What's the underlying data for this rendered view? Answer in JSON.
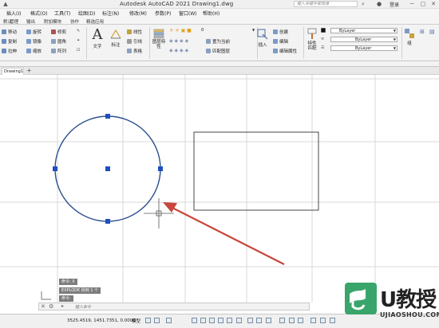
{
  "window": {
    "title": "Autodesk AutoCAD 2021    Drawing1.dwg",
    "search_placeholder": "键入关键字或短语",
    "login": "登录"
  },
  "menubar": [
    "插入(I)",
    "格式(O)",
    "工具(T)",
    "绘图(D)",
    "标注(N)",
    "修改(M)",
    "参数(P)",
    "窗口(W)",
    "帮助(H)"
  ],
  "ribbon_tabs": [
    "默认",
    "管理",
    "输出",
    "附加模块",
    "协作",
    "精选应用"
  ],
  "ribbon": {
    "modify": [
      {
        "label": "移动",
        "icon": "move-icon"
      },
      {
        "label": "旋转",
        "icon": "rotate-icon"
      },
      {
        "label": "修剪",
        "icon": "trim-icon"
      },
      {
        "label": "复制",
        "icon": "copy-icon"
      },
      {
        "label": "镜像",
        "icon": "mirror-icon"
      },
      {
        "label": "圆角",
        "icon": "fillet-icon"
      },
      {
        "label": "拉伸",
        "icon": "stretch-icon"
      },
      {
        "label": "缩放",
        "icon": "scale-icon"
      },
      {
        "label": "阵列",
        "icon": "array-icon"
      }
    ],
    "annotation": {
      "text": "文字",
      "dimension": "标注",
      "linear": "线性",
      "leader": "引线",
      "table": "表格"
    },
    "layers": {
      "layer_properties": "图层特性",
      "current_layer": "0",
      "make_current": "置为当前",
      "match_layer": "匹配图层"
    },
    "block": {
      "insert": "插入",
      "create": "创建",
      "edit": "编辑",
      "edit_attributes": "编辑属性"
    },
    "properties": {
      "match": "特性匹配",
      "color": "ByLayer",
      "linetype": "ByLayer",
      "lineweight": "ByLayer"
    },
    "groups": {
      "group": "组"
    }
  },
  "doc_tab": "Drawing1",
  "command_history": [
    "命令: X",
    "EXPLODE 找到 1 个",
    "命令:"
  ],
  "command_placeholder": "键入命令",
  "status": {
    "coordinates": "3525.4519, 1451.7351, 0.0000",
    "model": "模型"
  },
  "colors": {
    "circle": "#2b4f8f",
    "grips": "#1f4fbf",
    "arrow": "#c8463c",
    "grid": "#d9d9d9"
  },
  "watermark": {
    "brand": "U教授",
    "site": "UJIAOSHOU.COM"
  }
}
